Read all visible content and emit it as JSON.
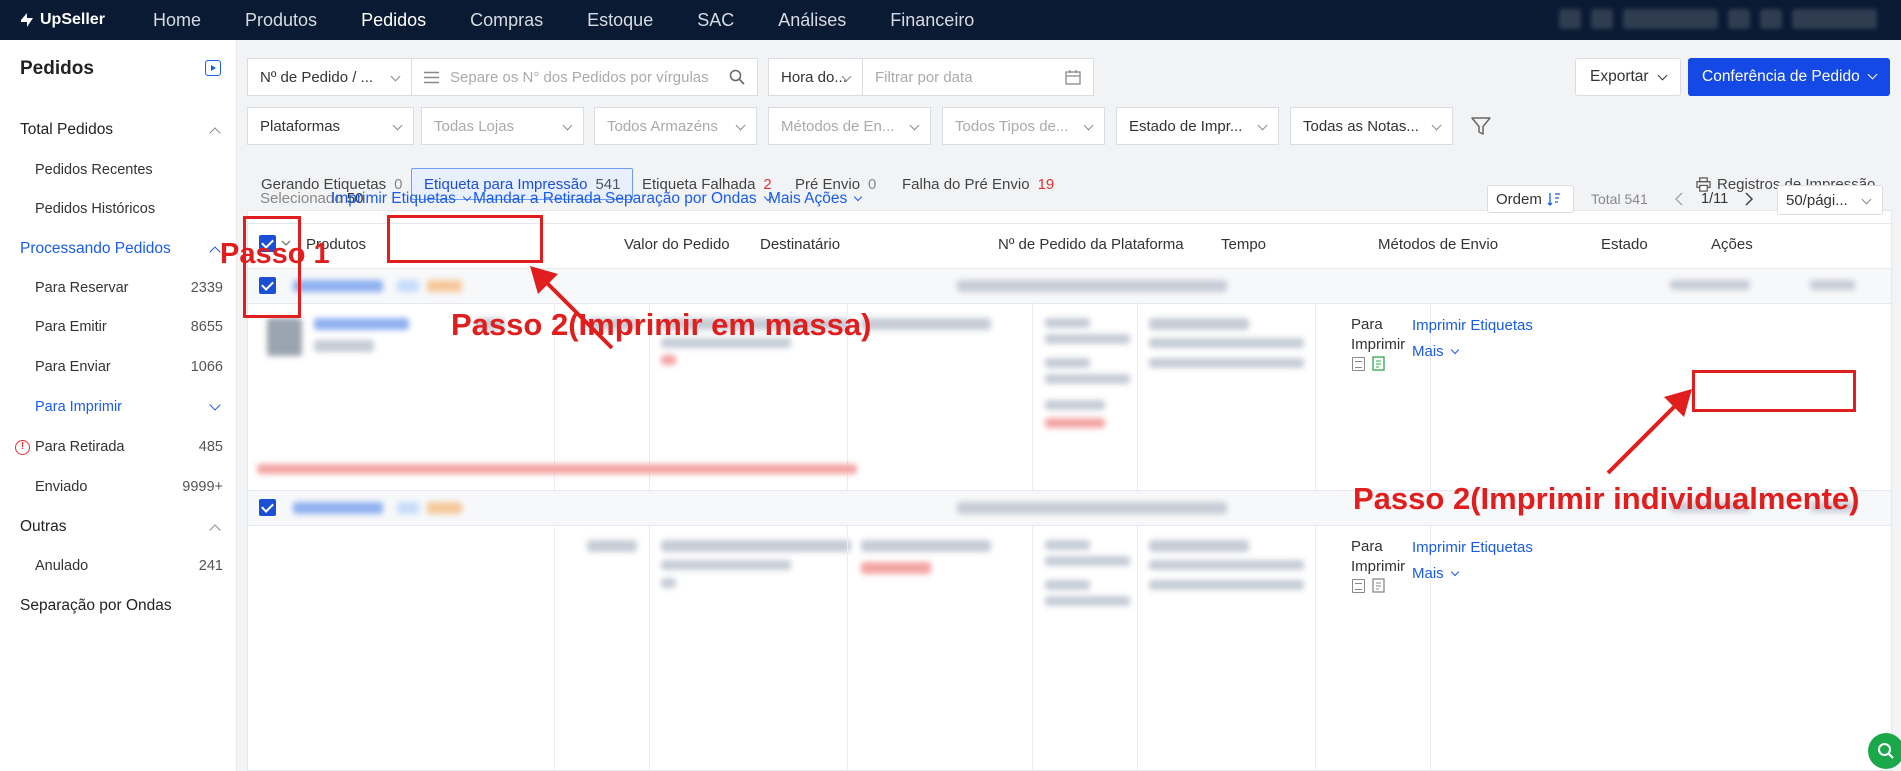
{
  "brand": {
    "name": "UpSeller"
  },
  "nav": [
    "Home",
    "Produtos",
    "Pedidos",
    "Compras",
    "Estoque",
    "SAC",
    "Análises",
    "Financeiro"
  ],
  "sidebar": {
    "title": "Pedidos",
    "groups": {
      "total": "Total Pedidos",
      "recentes": "Pedidos Recentes",
      "historicos": "Pedidos Históricos",
      "processando": "Processando Pedidos",
      "reservar": {
        "label": "Para Reservar",
        "count": "2339"
      },
      "emitir": {
        "label": "Para Emitir",
        "count": "8655"
      },
      "enviar": {
        "label": "Para Enviar",
        "count": "1066"
      },
      "imprimir": {
        "label": "Para Imprimir"
      },
      "retirada": {
        "label": "Para Retirada",
        "count": "485"
      },
      "enviado": {
        "label": "Enviado",
        "count": "9999+"
      },
      "outras": "Outras",
      "anulado": {
        "label": "Anulado",
        "count": "241"
      },
      "separacao": "Separação por Ondas"
    }
  },
  "filters": {
    "order_type": "Nº de Pedido / ...",
    "search_placeholder": "Separe os N° dos Pedidos por vírgulas",
    "time": "Hora do...",
    "date_placeholder": "Filtrar por data",
    "platforms": "Plataformas",
    "stores": "Todas Lojas",
    "warehouses": "Todos Armazéns",
    "shipping_methods": "Métodos de En...",
    "types": "Todos Tipos de...",
    "print_state": "Estado de Impr...",
    "invoices": "Todas as Notas..."
  },
  "actions": {
    "export": "Exportar",
    "conference": "Conferência de Pedido"
  },
  "status_tabs": [
    {
      "label": "Gerando Etiquetas",
      "count": "0"
    },
    {
      "label": "Etiqueta para Impressão",
      "count": "541"
    },
    {
      "label": "Etiqueta Falhada",
      "count": "2"
    },
    {
      "label": "Pré Envio",
      "count": "0"
    },
    {
      "label": "Falha do Pré Envio",
      "count": "19"
    }
  ],
  "print_records": "Registros de Impressão",
  "toolbar": {
    "selected_label": "Selecionado",
    "selected_count": "50",
    "print_labels": "Imprimir Etiquetas",
    "pickup": "Mandar a Retirada",
    "waves": "Separação por Ondas",
    "more": "Mais Ações",
    "order": "Ordem",
    "total": "Total 541",
    "page": "1/11",
    "per_page": "50/pági..."
  },
  "columns": [
    "Produtos",
    "Valor do Pedido",
    "Destinatário",
    "Nº de Pedido da Plataforma",
    "Tempo",
    "Métodos de Envio",
    "Estado",
    "Ações"
  ],
  "rows": [
    {
      "state_line1": "Para",
      "state_line2": "Imprimir",
      "action": "Imprimir Etiquetas",
      "more": "Mais"
    },
    {
      "state_line1": "Para",
      "state_line2": "Imprimir",
      "action": "Imprimir Etiquetas",
      "more": "Mais"
    }
  ],
  "annotations": {
    "step1": "Passo 1",
    "step2_bulk": "Passo 2(Imprimir em massa)",
    "step2_single": "Passo 2(Imprimir individualmente)"
  },
  "colors": {
    "nav_bg": "#0a1a33",
    "accent": "#1a5ce6",
    "annotation": "#e01e1e",
    "primary_button": "#1449e6"
  }
}
